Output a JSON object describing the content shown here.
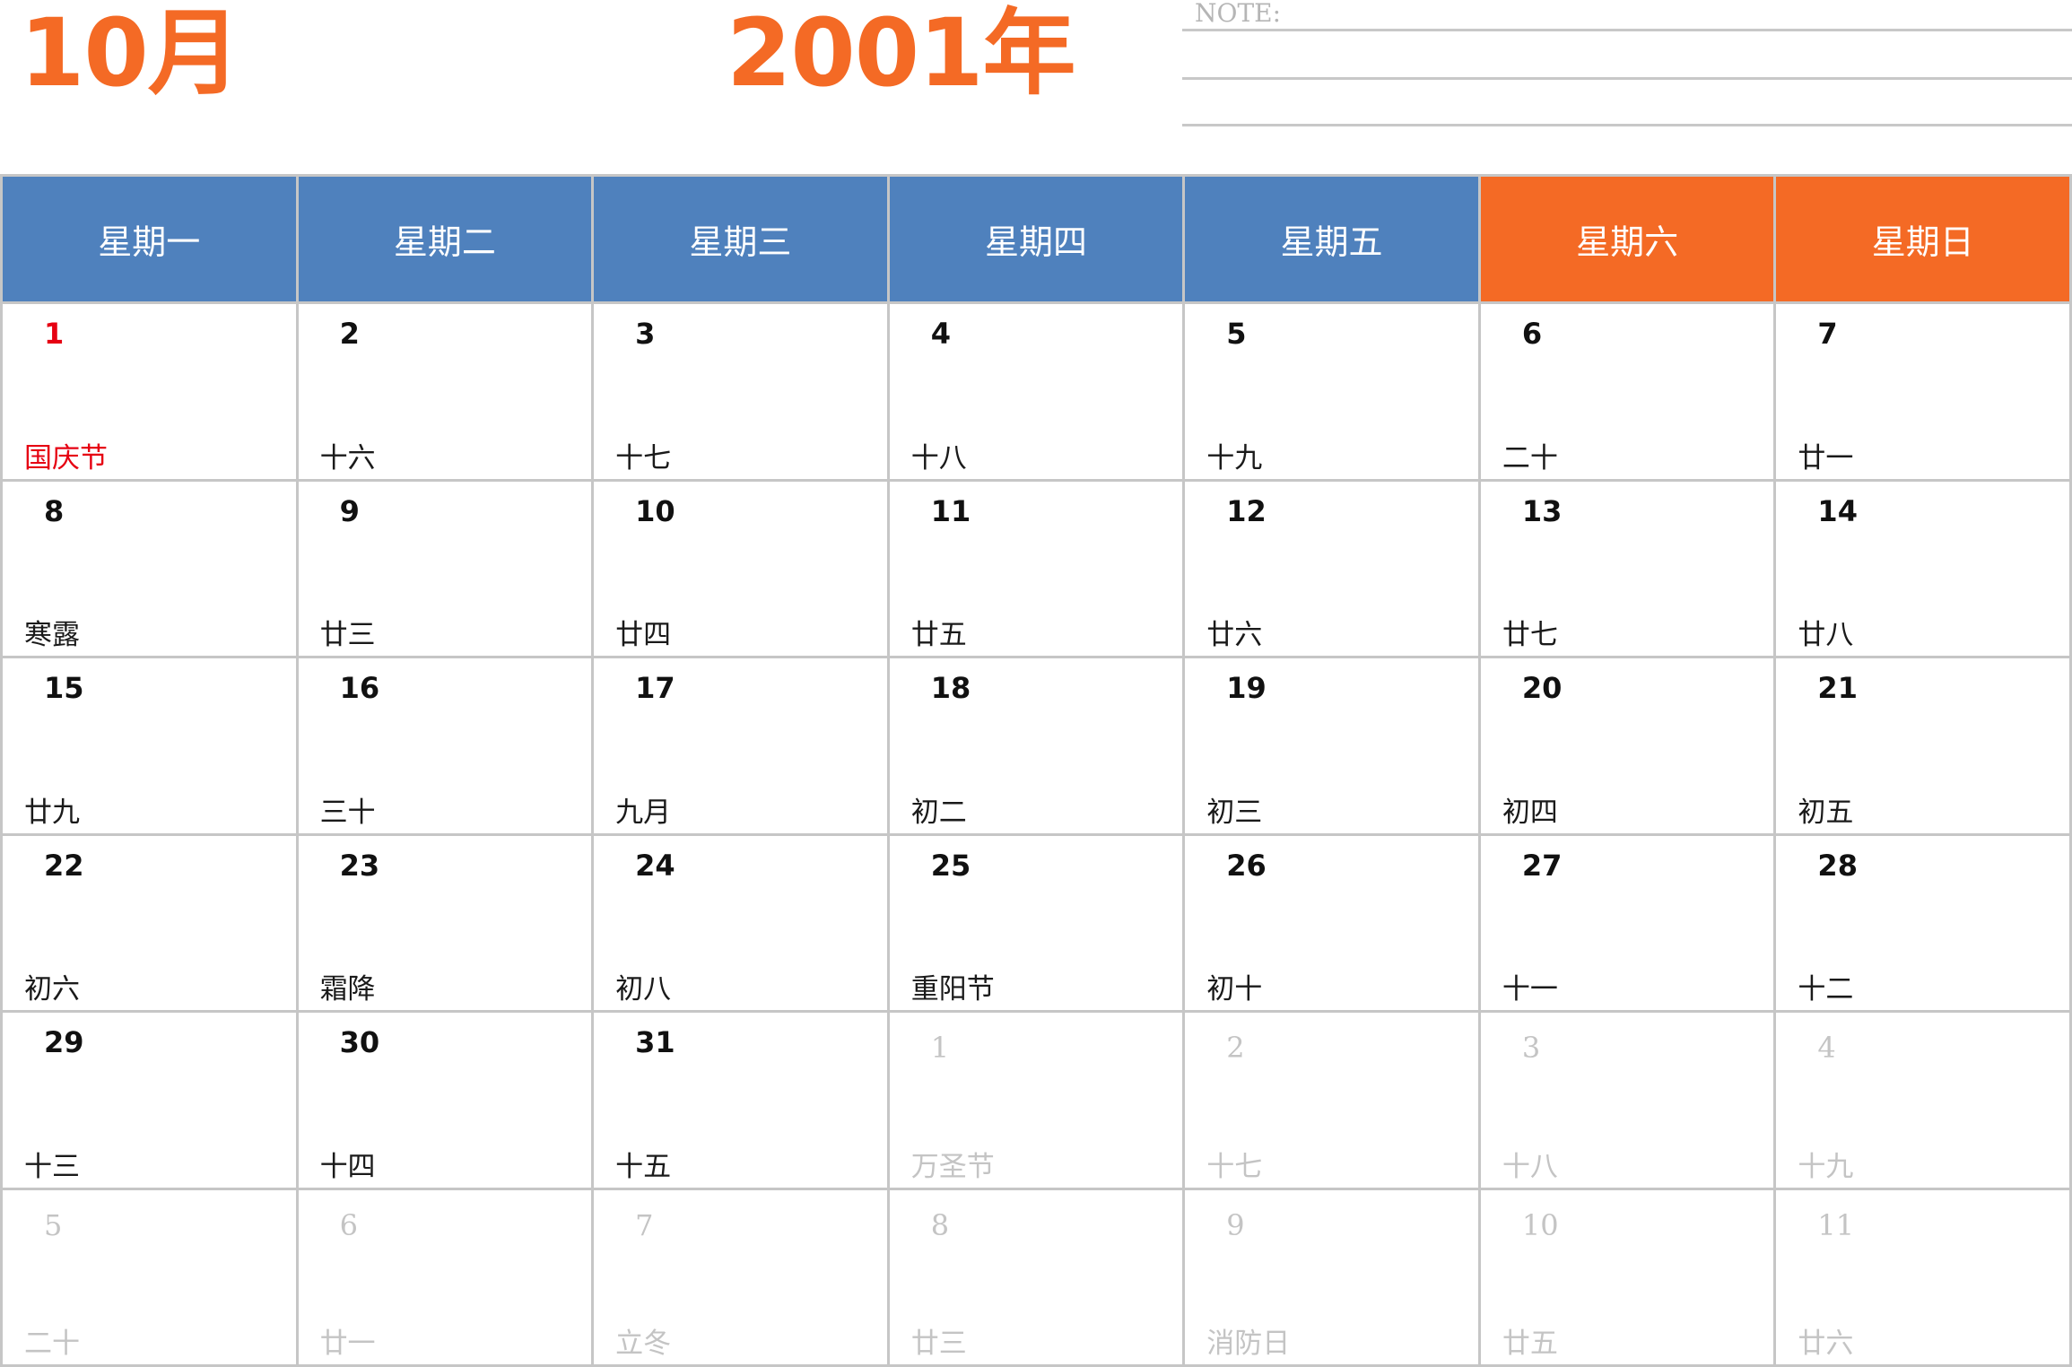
{
  "header": {
    "month": "10月",
    "year": "2001年",
    "note_label": "NOTE:"
  },
  "weekdays": [
    "星期一",
    "星期二",
    "星期三",
    "星期四",
    "星期五",
    "星期六",
    "星期日"
  ],
  "colors": {
    "title": "#f46a25",
    "weekday_header": "#4f81bd",
    "weekend_header": "#f46a25",
    "holiday": "#e60012",
    "other_month": "#c4c4c4",
    "grid_line": "#c6c6c6"
  },
  "weeks": [
    [
      {
        "day": "1",
        "lunar": "国庆节",
        "type": "holiday"
      },
      {
        "day": "2",
        "lunar": "十六",
        "type": "current"
      },
      {
        "day": "3",
        "lunar": "十七",
        "type": "current"
      },
      {
        "day": "4",
        "lunar": "十八",
        "type": "current"
      },
      {
        "day": "5",
        "lunar": "十九",
        "type": "current"
      },
      {
        "day": "6",
        "lunar": "二十",
        "type": "current"
      },
      {
        "day": "7",
        "lunar": "廿一",
        "type": "current"
      }
    ],
    [
      {
        "day": "8",
        "lunar": "寒露",
        "type": "current"
      },
      {
        "day": "9",
        "lunar": "廿三",
        "type": "current"
      },
      {
        "day": "10",
        "lunar": "廿四",
        "type": "current"
      },
      {
        "day": "11",
        "lunar": "廿五",
        "type": "current"
      },
      {
        "day": "12",
        "lunar": "廿六",
        "type": "current"
      },
      {
        "day": "13",
        "lunar": "廿七",
        "type": "current"
      },
      {
        "day": "14",
        "lunar": "廿八",
        "type": "current"
      }
    ],
    [
      {
        "day": "15",
        "lunar": "廿九",
        "type": "current"
      },
      {
        "day": "16",
        "lunar": "三十",
        "type": "current"
      },
      {
        "day": "17",
        "lunar": "九月",
        "type": "current"
      },
      {
        "day": "18",
        "lunar": "初二",
        "type": "current"
      },
      {
        "day": "19",
        "lunar": "初三",
        "type": "current"
      },
      {
        "day": "20",
        "lunar": "初四",
        "type": "current"
      },
      {
        "day": "21",
        "lunar": "初五",
        "type": "current"
      }
    ],
    [
      {
        "day": "22",
        "lunar": "初六",
        "type": "current"
      },
      {
        "day": "23",
        "lunar": "霜降",
        "type": "current"
      },
      {
        "day": "24",
        "lunar": "初八",
        "type": "current"
      },
      {
        "day": "25",
        "lunar": "重阳节",
        "type": "current"
      },
      {
        "day": "26",
        "lunar": "初十",
        "type": "current"
      },
      {
        "day": "27",
        "lunar": "十一",
        "type": "current"
      },
      {
        "day": "28",
        "lunar": "十二",
        "type": "current"
      }
    ],
    [
      {
        "day": "29",
        "lunar": "十三",
        "type": "current"
      },
      {
        "day": "30",
        "lunar": "十四",
        "type": "current"
      },
      {
        "day": "31",
        "lunar": "十五",
        "type": "current"
      },
      {
        "day": "1",
        "lunar": "万圣节",
        "type": "other"
      },
      {
        "day": "2",
        "lunar": "十七",
        "type": "other"
      },
      {
        "day": "3",
        "lunar": "十八",
        "type": "other"
      },
      {
        "day": "4",
        "lunar": "十九",
        "type": "other"
      }
    ],
    [
      {
        "day": "5",
        "lunar": "二十",
        "type": "other"
      },
      {
        "day": "6",
        "lunar": "廿一",
        "type": "other"
      },
      {
        "day": "7",
        "lunar": "立冬",
        "type": "other"
      },
      {
        "day": "8",
        "lunar": "廿三",
        "type": "other"
      },
      {
        "day": "9",
        "lunar": "消防日",
        "type": "other"
      },
      {
        "day": "10",
        "lunar": "廿五",
        "type": "other"
      },
      {
        "day": "11",
        "lunar": "廿六",
        "type": "other"
      }
    ]
  ]
}
